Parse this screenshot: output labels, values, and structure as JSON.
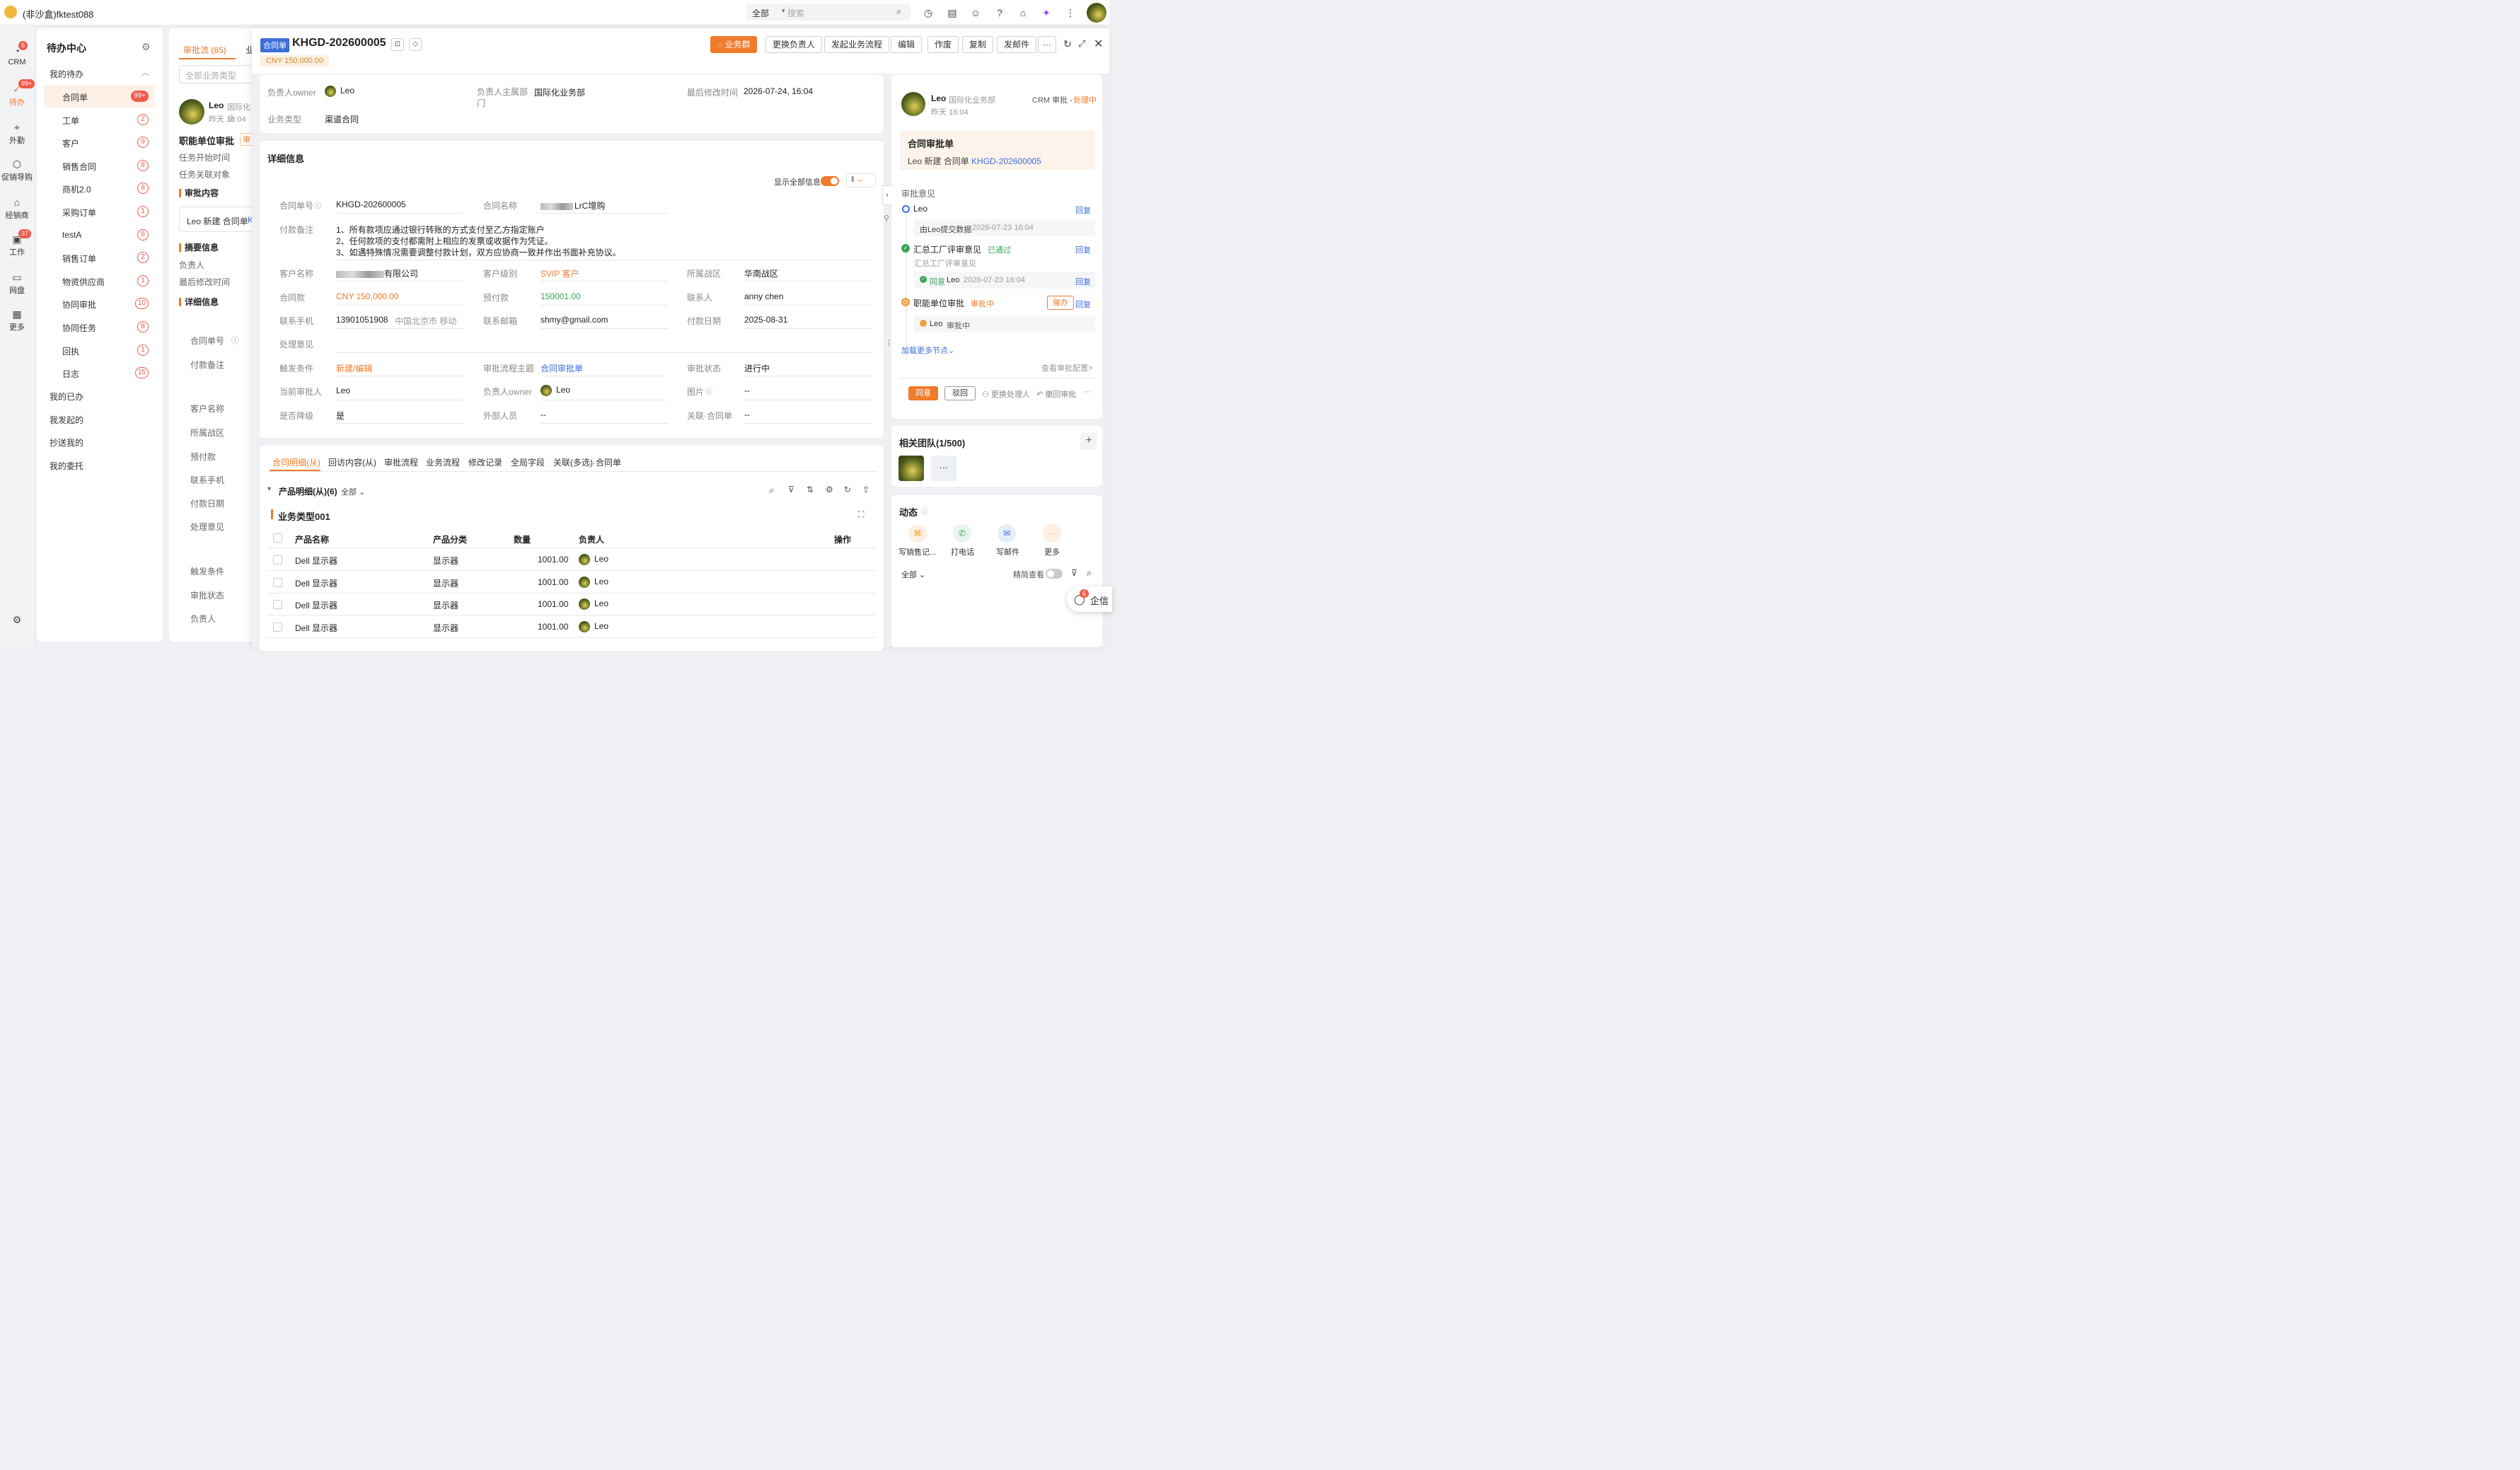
{
  "topbar": {
    "app_name": "(非沙盒)fktest088",
    "search_scope": "全部",
    "search_placeholder": "搜索"
  },
  "rail": {
    "items": [
      {
        "label": "CRM",
        "badge": "6"
      },
      {
        "label": "待办",
        "badge": "99+"
      },
      {
        "label": "外勤",
        "badge": ""
      },
      {
        "label": "促销导购",
        "badge": ""
      },
      {
        "label": "经销商",
        "badge": ""
      },
      {
        "label": "工作",
        "badge": "37"
      },
      {
        "label": "网盘",
        "badge": ""
      },
      {
        "label": "更多",
        "badge": ""
      }
    ]
  },
  "pending": {
    "title": "待办中心",
    "group_my_todo": "我的待办",
    "items": [
      {
        "label": "合同单",
        "count": "99+"
      },
      {
        "label": "工单",
        "count": "2"
      },
      {
        "label": "客户",
        "count": "9"
      },
      {
        "label": "销售合同",
        "count": "8"
      },
      {
        "label": "商机2.0",
        "count": "8"
      },
      {
        "label": "采购订单",
        "count": "1"
      },
      {
        "label": "testA",
        "count": "8"
      },
      {
        "label": "销售订单",
        "count": "2"
      },
      {
        "label": "物资供应商",
        "count": "1"
      },
      {
        "label": "协同审批",
        "count": "10"
      },
      {
        "label": "协同任务",
        "count": "8"
      },
      {
        "label": "回执",
        "count": "1"
      },
      {
        "label": "日志",
        "count": "15"
      }
    ],
    "groups": [
      "我的已办",
      "我发起的",
      "抄送我的",
      "我的委托"
    ]
  },
  "flowcol": {
    "tab1": "审批流 (85)",
    "tab2": "业",
    "select_placeholder": "全部业务类型",
    "user": "Leo",
    "dept": "国际化业",
    "time": "昨天 16:04",
    "title": "职能单位审批",
    "tag": "审",
    "start_time": "任务开始时间",
    "related": "任务关联对象",
    "sec_content": "审批内容",
    "content_text": "Leo 新建 合同单",
    "content_link": "K",
    "sec_summary": "摘要信息",
    "summary_owner": "负责人",
    "summary_modified": "最后修改时间",
    "sec_detail": "详细信息",
    "fields": [
      "合同单号",
      "付款备注",
      "客户名称",
      "所属战区",
      "预付款",
      "联系手机",
      "付款日期",
      "处理意见",
      "触发条件",
      "审批状态",
      "负责人"
    ]
  },
  "header": {
    "tag": "合同单",
    "doc_no": "KHGD-202600005",
    "amount": "CNY 150,000.00",
    "buttons": [
      "业务群",
      "更换负责人",
      "发起业务流程",
      "编辑",
      "作废",
      "复制",
      "发邮件"
    ],
    "more": "···"
  },
  "summary": {
    "owner_label": "负责人owner",
    "owner": "Leo",
    "dept_label": "负责人主属部门",
    "dept": "国际化业务部",
    "modified_label": "最后修改时间",
    "modified": "2026-07-24, 16:04",
    "type_label": "业务类型",
    "type": "渠道合同"
  },
  "detail": {
    "title": "详细信息",
    "show_all": "显示全部信息",
    "contract_no_label": "合同单号",
    "contract_no": "KHGD-202600005",
    "contract_name_label": "合同名称",
    "contract_name": "LrC增购",
    "remark_label": "付款备注",
    "remark_lines": [
      "1、所有款项应通过银行转账的方式支付至乙方指定账户",
      "2、任何款项的支付都需附上相应的发票或收据作为凭证。",
      "3、如遇特殊情况需要调整付款计划，双方应协商一致并作出书面补充协议。"
    ],
    "customer_label": "客户名称",
    "customer": "有限公司",
    "level_label": "客户级别",
    "level": "SVIP 客户",
    "zone_label": "所属战区",
    "zone": "华南战区",
    "amount_label": "合同款",
    "amount": "CNY 150,000.00",
    "prepay_label": "预付款",
    "prepay": "150001.00",
    "contact_label": "联系人",
    "contact": "anny chen",
    "phone_label": "联系手机",
    "phone": "13901051908",
    "phone_loc": "中国北京市 移动",
    "email_label": "联系邮箱",
    "email": "shmy@gmail.com",
    "paydate_label": "付款日期",
    "paydate": "2025-08-31",
    "opinion_label": "处理意见",
    "trigger_label": "触发条件",
    "trigger": "新建/编辑",
    "flow_label": "审批流程主题",
    "flow": "合同审批单",
    "status_label": "审批状态",
    "status": "进行中",
    "approver_label": "当前审批人",
    "approver": "Leo",
    "owner_label": "负责人owner",
    "owner": "Leo",
    "image_label": "图片",
    "image": "--",
    "downgrade_label": "是否降级",
    "downgrade": "是",
    "external_label": "外部人员",
    "external": "--",
    "related_label": "关联·合同单",
    "related": "--"
  },
  "tabs": [
    "合同明细(从)",
    "回访内容(从)",
    "审批流程",
    "业务流程",
    "修改记录",
    "全局字段",
    "关联(多选)·合同单"
  ],
  "products": {
    "title": "产品明细(从)(6)",
    "filter": "全部",
    "group": "业务类型001",
    "headers": [
      "产品名称",
      "产品分类",
      "数量",
      "负责人",
      "操作"
    ],
    "rows": [
      {
        "name": "Dell 显示器",
        "cat": "显示器",
        "qty": "1001.00",
        "owner": "Leo"
      },
      {
        "name": "Dell 显示器",
        "cat": "显示器",
        "qty": "1001.00",
        "owner": "Leo"
      },
      {
        "name": "Dell 显示器",
        "cat": "显示器",
        "qty": "1001.00",
        "owner": "Leo"
      },
      {
        "name": "Dell 显示器",
        "cat": "显示器",
        "qty": "1001.00",
        "owner": "Leo"
      }
    ]
  },
  "approval": {
    "user": "Leo",
    "dept": "国际化业务部",
    "time": "昨天 16:04",
    "crm": "CRM 审批 - ",
    "state": "处理中",
    "form_title": "合同审批单",
    "form_text": "Leo 新建 合同单 ",
    "form_link": "KHGD-202600005",
    "opinion_title": "审批意见",
    "n1_name": "Leo",
    "n1_reply": "回复",
    "n1_note": "由Leo提交数据",
    "n1_time": "2026-07-23 16:04",
    "n2_name": "汇总工厂评审意见",
    "n2_state": "已通过",
    "n2_reply": "回复",
    "n2_sub": "汇总工厂评审意见",
    "n2_agree": "同意",
    "n2_user": "Leo",
    "n2_time": "2026-07-23 16:04",
    "n2_reply2": "回复",
    "n3_name": "职能单位审批",
    "n3_state": "审批中",
    "n3_urge": "催办",
    "n3_reply": "回复",
    "n3_user": "Leo",
    "n3_note": "审批中",
    "load_more": "加载更多节点",
    "view_config": "查看审批配置>",
    "btn_agree": "同意",
    "btn_reject": "驳回",
    "btn_change": "更换处理人",
    "btn_withdraw": "撤回审批",
    "btn_more": "···"
  },
  "team": {
    "title": "相关团队(1/500)",
    "more": "···"
  },
  "activity": {
    "title": "动态",
    "actions": [
      "写销售记...",
      "打电话",
      "写邮件",
      "更多"
    ],
    "filter": "全部",
    "compact": "精简查看"
  },
  "float": {
    "label": "企信",
    "badge": "6"
  }
}
